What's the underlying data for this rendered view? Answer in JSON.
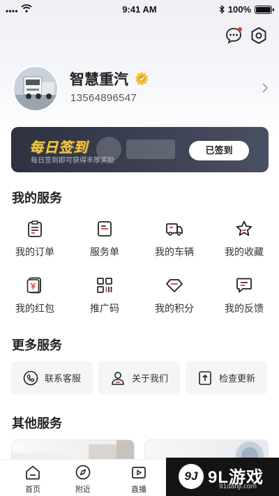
{
  "status_bar": {
    "time": "9:41 AM",
    "battery": "100%",
    "battery_level": 1.0
  },
  "profile": {
    "name": "智慧重汽",
    "phone": "13564896547"
  },
  "checkin": {
    "title": "每日签到",
    "subtitle": "每日签到即可获得丰厚奖励",
    "button": "已签到"
  },
  "my_services": {
    "title": "我的服务",
    "items": [
      {
        "label": "我的订单",
        "icon": "clipboard-icon"
      },
      {
        "label": "服务单",
        "icon": "document-icon"
      },
      {
        "label": "我的车辆",
        "icon": "truck-icon"
      },
      {
        "label": "我的收藏",
        "icon": "star-icon"
      },
      {
        "label": "我的红包",
        "icon": "red-packet-icon"
      },
      {
        "label": "推广码",
        "icon": "qr-code-icon"
      },
      {
        "label": "我的积分",
        "icon": "diamond-icon"
      },
      {
        "label": "我的反馈",
        "icon": "feedback-icon"
      }
    ]
  },
  "more_services": {
    "title": "更多服务",
    "items": [
      {
        "label": "联系客服",
        "icon": "phone-icon"
      },
      {
        "label": "关于我们",
        "icon": "user-icon"
      },
      {
        "label": "检查更新",
        "icon": "update-icon"
      }
    ]
  },
  "other_services": {
    "title": "其他服务"
  },
  "bottom_nav": {
    "items": [
      {
        "label": "首页",
        "icon": "home-icon"
      },
      {
        "label": "附近",
        "icon": "compass-icon"
      },
      {
        "label": "直播",
        "icon": "live-icon"
      }
    ]
  },
  "watermark": {
    "logo": "9J",
    "main": "9L游戏",
    "sub": "91danji.com"
  }
}
